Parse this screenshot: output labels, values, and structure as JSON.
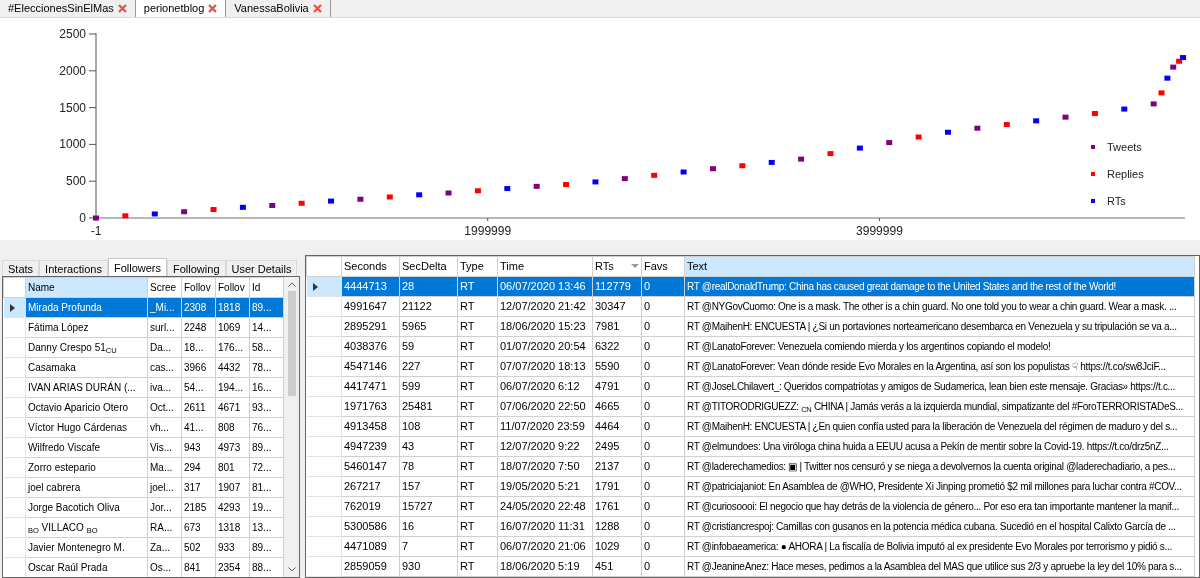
{
  "document_tabs": [
    {
      "label": "#EleccionesSinElMas",
      "selected": false
    },
    {
      "label": "perionetblog",
      "selected": true
    },
    {
      "label": "VanessaBolivia",
      "selected": false
    }
  ],
  "chart": {
    "chart_data": {
      "type": "scatter",
      "xlim": [
        -1,
        5560000
      ],
      "ylim": [
        0,
        2500
      ],
      "yticks": [
        0,
        500,
        1000,
        1500,
        2000,
        2500
      ],
      "xticks": [
        -1,
        1999999,
        3999999
      ],
      "legend": true,
      "x": [
        0,
        150000,
        300000,
        450000,
        600000,
        750000,
        900000,
        1050000,
        1200000,
        1350000,
        1500000,
        1650000,
        1800000,
        1950000,
        2100000,
        2250000,
        2400000,
        2550000,
        2700000,
        2850000,
        3000000,
        3150000,
        3300000,
        3450000,
        3600000,
        3750000,
        3900000,
        4050000,
        4200000,
        4350000,
        4500000,
        4650000,
        4800000,
        4950000,
        5100000,
        5250000,
        5400000,
        5440000,
        5470000,
        5500000,
        5530000,
        5550000
      ],
      "series": [
        {
          "name": "Tweets",
          "color": "#800080",
          "values": [
            0,
            null,
            null,
            85,
            null,
            null,
            170,
            null,
            null,
            255,
            null,
            null,
            340,
            null,
            null,
            430,
            null,
            null,
            535,
            null,
            null,
            670,
            null,
            null,
            800,
            null,
            null,
            1025,
            null,
            null,
            1220,
            null,
            null,
            1370,
            null,
            null,
            1550,
            null,
            null,
            2050,
            null,
            null
          ]
        },
        {
          "name": "Replies",
          "color": "#ff0000",
          "values": [
            null,
            30,
            null,
            null,
            115,
            null,
            null,
            200,
            null,
            null,
            285,
            null,
            null,
            370,
            null,
            null,
            455,
            null,
            null,
            580,
            null,
            null,
            710,
            null,
            null,
            875,
            null,
            null,
            1100,
            null,
            null,
            1270,
            null,
            null,
            1420,
            null,
            null,
            1700,
            null,
            null,
            2130,
            null
          ]
        },
        {
          "name": "RTs",
          "color": "#0000ff",
          "values": [
            null,
            null,
            55,
            null,
            null,
            145,
            null,
            null,
            230,
            null,
            null,
            315,
            null,
            null,
            400,
            null,
            null,
            490,
            null,
            null,
            625,
            null,
            null,
            755,
            null,
            null,
            950,
            null,
            null,
            1165,
            null,
            null,
            1320,
            null,
            null,
            1480,
            null,
            null,
            1900,
            null,
            null,
            2180
          ]
        }
      ]
    }
  },
  "user_tabs": [
    {
      "label": "Stats",
      "selected": false
    },
    {
      "label": "Interactions",
      "selected": false
    },
    {
      "label": "Followers",
      "selected": true
    },
    {
      "label": "Following",
      "selected": false
    },
    {
      "label": "User Details",
      "selected": false
    }
  ],
  "followers_table": {
    "columns": [
      {
        "label": "Name",
        "highlighted": true
      },
      {
        "label": "Scree",
        "highlighted": false
      },
      {
        "label": "Follov",
        "highlighted": false
      },
      {
        "label": "Follov",
        "highlighted": false
      },
      {
        "label": "Id",
        "highlighted": false
      }
    ],
    "rows": [
      {
        "selected": true,
        "cells": [
          "Mirada Profunda",
          "_Mi...",
          "2308",
          "1818",
          "89..."
        ]
      },
      {
        "selected": false,
        "cells": [
          "Fátima López",
          "surl...",
          "2248",
          "1069",
          "14..."
        ]
      },
      {
        "selected": false,
        "cells": [
          "Danny Crespo 51$_{CU}$",
          "Da...",
          "18...",
          "176...",
          "58..."
        ]
      },
      {
        "selected": false,
        "cells": [
          "Casamaka",
          "cas...",
          "3966",
          "4432",
          "78..."
        ]
      },
      {
        "selected": false,
        "cells": [
          "IVAN ARIAS DURÁN (...",
          "iva...",
          "54...",
          "194...",
          "16..."
        ]
      },
      {
        "selected": false,
        "cells": [
          "Octavio Aparicio Otero",
          "Oct...",
          "2611",
          "4671",
          "93..."
        ]
      },
      {
        "selected": false,
        "cells": [
          "Víctor Hugo Cárdenas",
          "vh...",
          "41...",
          "808",
          "76..."
        ]
      },
      {
        "selected": false,
        "cells": [
          "Wilfredo Viscafe",
          "Vis...",
          "943",
          "4973",
          "89..."
        ]
      },
      {
        "selected": false,
        "cells": [
          "Zorro estepario",
          "Ma...",
          "294",
          "801",
          "72..."
        ]
      },
      {
        "selected": false,
        "cells": [
          "joel cabrera",
          "joel...",
          "317",
          "1907",
          "81..."
        ]
      },
      {
        "selected": false,
        "cells": [
          "Jorge Bacotich Oliva",
          "Jor...",
          "2185",
          "4293",
          "19..."
        ]
      },
      {
        "selected": false,
        "cells": [
          "$_{BO}$ VILLACO $_{BO}$",
          "RA...",
          "673",
          "1318",
          "13..."
        ]
      },
      {
        "selected": false,
        "cells": [
          "Javier Montenegro M.",
          "Za...",
          "502",
          "933",
          "89..."
        ]
      },
      {
        "selected": false,
        "cells": [
          "Oscar Raúl Prada",
          "Os...",
          "841",
          "2354",
          "88..."
        ]
      }
    ]
  },
  "tweets_table": {
    "columns": [
      {
        "label": "Seconds",
        "highlighted": false,
        "sort_descending": false
      },
      {
        "label": "SecDelta",
        "highlighted": false,
        "sort_descending": false
      },
      {
        "label": "Type",
        "highlighted": false,
        "sort_descending": false
      },
      {
        "label": "Time",
        "highlighted": false,
        "sort_descending": false
      },
      {
        "label": "RTs",
        "highlighted": false,
        "sort_descending": true
      },
      {
        "label": "Favs",
        "highlighted": false,
        "sort_descending": false
      },
      {
        "label": "Text",
        "highlighted": true,
        "sort_descending": false
      }
    ],
    "rows": [
      {
        "selected": true,
        "cells": [
          "4444713",
          "28",
          "RT",
          "06/07/2020 13:46",
          "112779",
          "0",
          "RT @realDonaldTrump: China has caused great damage to the United States and the rest of the World!"
        ]
      },
      {
        "selected": false,
        "cells": [
          "4991647",
          "21122",
          "RT",
          "12/07/2020 21:42",
          "30347",
          "0",
          "RT @NYGovCuomo: One is a mask. The other is a chin guard. No one told you to wear a chin guard. Wear a mask. ..."
        ]
      },
      {
        "selected": false,
        "cells": [
          "2895291",
          "5965",
          "RT",
          "18/06/2020 15:23",
          "7981",
          "0",
          "RT @MaihenH: ENCUESTA |  ¿Si un portaviones norteamericano desembarca en Venezuela y su tripulación se va a..."
        ]
      },
      {
        "selected": false,
        "cells": [
          "4038376",
          "59",
          "RT",
          "01/07/2020 20:54",
          "6322",
          "0",
          "RT @LanatoForever: Venezuela comiendo mierda y los argentinos copiando el modelo!"
        ]
      },
      {
        "selected": false,
        "cells": [
          "4547146",
          "227",
          "RT",
          "07/07/2020 18:13",
          "5590",
          "0",
          "RT @LanatoForever: Vean dónde reside Evo Morales en la Argentina, así son los populistas ☟ https://t.co/sw8JciF..."
        ]
      },
      {
        "selected": false,
        "cells": [
          "4417471",
          "599",
          "RT",
          "06/07/2020 6:12",
          "4791",
          "0",
          "RT @JoseLChilavert_: Queridos compatriotas y amigos de Sudamerica, lean bien este mensaje. Gracias» https://t.c..."
        ]
      },
      {
        "selected": false,
        "cells": [
          "1971763",
          "25481",
          "RT",
          "07/06/2020 22:50",
          "4665",
          "0",
          "RT @TITORODRIGUEZZ: $_{CN}$ CHINA | Jamás verás a la izquierda mundial, simpatizante del #ForoTERRORISTADeS..."
        ]
      },
      {
        "selected": false,
        "cells": [
          "4913458",
          "108",
          "RT",
          "11/07/2020 23:59",
          "4464",
          "0",
          "RT @MaihenH: ENCUESTA | ¿En quien confía usted para la liberación de Venezuela del régimen de maduro y del s..."
        ]
      },
      {
        "selected": false,
        "cells": [
          "4947239",
          "43",
          "RT",
          "12/07/2020 9:22",
          "2495",
          "0",
          "RT @elmundoes: Una viróloga china huida a EEUU acusa a Pekín de mentir sobre la Covid-19. https://t.co/drz5nZ..."
        ]
      },
      {
        "selected": false,
        "cells": [
          "5460147",
          "78",
          "RT",
          "18/07/2020 7:50",
          "2137",
          "0",
          "RT @laderechamedios: ▣ | Twitter nos censuró y se niega a devolvernos la cuenta original @laderechadiario, a pes..."
        ]
      },
      {
        "selected": false,
        "cells": [
          "267217",
          "157",
          "RT",
          "19/05/2020 5:21",
          "1791",
          "0",
          "RT @patriciajaniot: En Asamblea de @WHO, Presidente Xi Jinping prometió $2 mil millones para luchar contra #COV..."
        ]
      },
      {
        "selected": false,
        "cells": [
          "762019",
          "15727",
          "RT",
          "24/05/2020 22:48",
          "1761",
          "0",
          "RT @curiosoooi: El negocio que hay detrás de la violencia de género... Por eso era tan importante mantener la manif..."
        ]
      },
      {
        "selected": false,
        "cells": [
          "5300586",
          "16",
          "RT",
          "16/07/2020 11:31",
          "1288",
          "0",
          "RT @cristiancrespoj: Camillas con gusanos en la potencia médica cubana. Sucedió en el hospital Calixto García de ..."
        ]
      },
      {
        "selected": false,
        "cells": [
          "4471089",
          "7",
          "RT",
          "06/07/2020 21:06",
          "1029",
          "0",
          "RT @infobaeamerica: ● AHORA | La fiscalía de Bolivia imputó al ex presidente Evo Morales por terrorismo y pidió s..."
        ]
      },
      {
        "selected": false,
        "cells": [
          "2859059",
          "930",
          "RT",
          "18/06/2020 5:19",
          "451",
          "0",
          "RT @JeanineAnez: Hace meses, pedimos a la Asamblea del MAS que utilice sus 2/3 y apruebe la ley del 10% para s..."
        ]
      }
    ]
  }
}
